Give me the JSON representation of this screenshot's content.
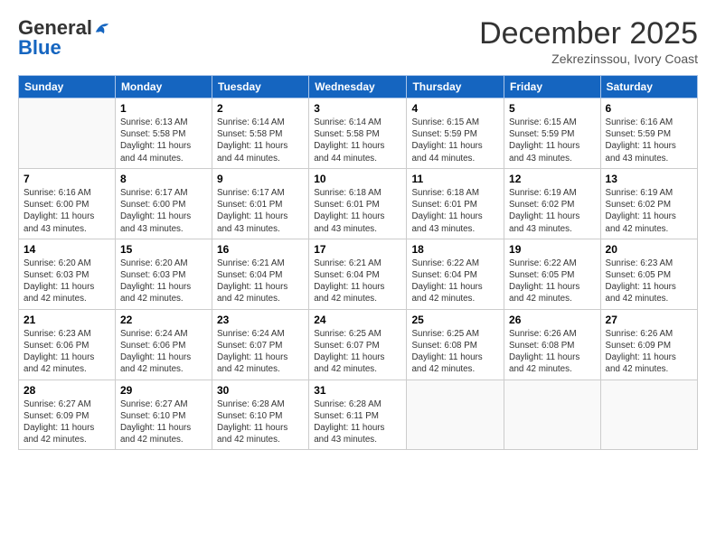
{
  "header": {
    "logo_general": "General",
    "logo_blue": "Blue",
    "month_title": "December 2025",
    "subtitle": "Zekrezinssou, Ivory Coast"
  },
  "weekdays": [
    "Sunday",
    "Monday",
    "Tuesday",
    "Wednesday",
    "Thursday",
    "Friday",
    "Saturday"
  ],
  "weeks": [
    [
      {
        "day": "",
        "sunrise": "",
        "sunset": "",
        "daylight": ""
      },
      {
        "day": "1",
        "sunrise": "6:13 AM",
        "sunset": "5:58 PM",
        "daylight": "11 hours and 44 minutes."
      },
      {
        "day": "2",
        "sunrise": "6:14 AM",
        "sunset": "5:58 PM",
        "daylight": "11 hours and 44 minutes."
      },
      {
        "day": "3",
        "sunrise": "6:14 AM",
        "sunset": "5:58 PM",
        "daylight": "11 hours and 44 minutes."
      },
      {
        "day": "4",
        "sunrise": "6:15 AM",
        "sunset": "5:59 PM",
        "daylight": "11 hours and 44 minutes."
      },
      {
        "day": "5",
        "sunrise": "6:15 AM",
        "sunset": "5:59 PM",
        "daylight": "11 hours and 43 minutes."
      },
      {
        "day": "6",
        "sunrise": "6:16 AM",
        "sunset": "5:59 PM",
        "daylight": "11 hours and 43 minutes."
      }
    ],
    [
      {
        "day": "7",
        "sunrise": "6:16 AM",
        "sunset": "6:00 PM",
        "daylight": "11 hours and 43 minutes."
      },
      {
        "day": "8",
        "sunrise": "6:17 AM",
        "sunset": "6:00 PM",
        "daylight": "11 hours and 43 minutes."
      },
      {
        "day": "9",
        "sunrise": "6:17 AM",
        "sunset": "6:01 PM",
        "daylight": "11 hours and 43 minutes."
      },
      {
        "day": "10",
        "sunrise": "6:18 AM",
        "sunset": "6:01 PM",
        "daylight": "11 hours and 43 minutes."
      },
      {
        "day": "11",
        "sunrise": "6:18 AM",
        "sunset": "6:01 PM",
        "daylight": "11 hours and 43 minutes."
      },
      {
        "day": "12",
        "sunrise": "6:19 AM",
        "sunset": "6:02 PM",
        "daylight": "11 hours and 43 minutes."
      },
      {
        "day": "13",
        "sunrise": "6:19 AM",
        "sunset": "6:02 PM",
        "daylight": "11 hours and 42 minutes."
      }
    ],
    [
      {
        "day": "14",
        "sunrise": "6:20 AM",
        "sunset": "6:03 PM",
        "daylight": "11 hours and 42 minutes."
      },
      {
        "day": "15",
        "sunrise": "6:20 AM",
        "sunset": "6:03 PM",
        "daylight": "11 hours and 42 minutes."
      },
      {
        "day": "16",
        "sunrise": "6:21 AM",
        "sunset": "6:04 PM",
        "daylight": "11 hours and 42 minutes."
      },
      {
        "day": "17",
        "sunrise": "6:21 AM",
        "sunset": "6:04 PM",
        "daylight": "11 hours and 42 minutes."
      },
      {
        "day": "18",
        "sunrise": "6:22 AM",
        "sunset": "6:04 PM",
        "daylight": "11 hours and 42 minutes."
      },
      {
        "day": "19",
        "sunrise": "6:22 AM",
        "sunset": "6:05 PM",
        "daylight": "11 hours and 42 minutes."
      },
      {
        "day": "20",
        "sunrise": "6:23 AM",
        "sunset": "6:05 PM",
        "daylight": "11 hours and 42 minutes."
      }
    ],
    [
      {
        "day": "21",
        "sunrise": "6:23 AM",
        "sunset": "6:06 PM",
        "daylight": "11 hours and 42 minutes."
      },
      {
        "day": "22",
        "sunrise": "6:24 AM",
        "sunset": "6:06 PM",
        "daylight": "11 hours and 42 minutes."
      },
      {
        "day": "23",
        "sunrise": "6:24 AM",
        "sunset": "6:07 PM",
        "daylight": "11 hours and 42 minutes."
      },
      {
        "day": "24",
        "sunrise": "6:25 AM",
        "sunset": "6:07 PM",
        "daylight": "11 hours and 42 minutes."
      },
      {
        "day": "25",
        "sunrise": "6:25 AM",
        "sunset": "6:08 PM",
        "daylight": "11 hours and 42 minutes."
      },
      {
        "day": "26",
        "sunrise": "6:26 AM",
        "sunset": "6:08 PM",
        "daylight": "11 hours and 42 minutes."
      },
      {
        "day": "27",
        "sunrise": "6:26 AM",
        "sunset": "6:09 PM",
        "daylight": "11 hours and 42 minutes."
      }
    ],
    [
      {
        "day": "28",
        "sunrise": "6:27 AM",
        "sunset": "6:09 PM",
        "daylight": "11 hours and 42 minutes."
      },
      {
        "day": "29",
        "sunrise": "6:27 AM",
        "sunset": "6:10 PM",
        "daylight": "11 hours and 42 minutes."
      },
      {
        "day": "30",
        "sunrise": "6:28 AM",
        "sunset": "6:10 PM",
        "daylight": "11 hours and 42 minutes."
      },
      {
        "day": "31",
        "sunrise": "6:28 AM",
        "sunset": "6:11 PM",
        "daylight": "11 hours and 43 minutes."
      },
      {
        "day": "",
        "sunrise": "",
        "sunset": "",
        "daylight": ""
      },
      {
        "day": "",
        "sunrise": "",
        "sunset": "",
        "daylight": ""
      },
      {
        "day": "",
        "sunrise": "",
        "sunset": "",
        "daylight": ""
      }
    ]
  ]
}
